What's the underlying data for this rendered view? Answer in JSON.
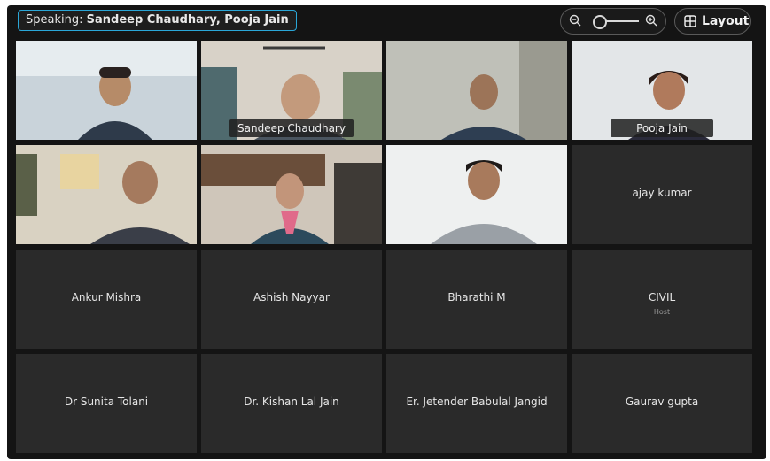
{
  "header": {
    "speaking_label": "Speaking:",
    "speaking_names": "Sandeep Chaudhary, Pooja Jain",
    "layout_label": "Layout"
  },
  "zoom": {
    "level": 0.2
  },
  "participants": [
    {
      "id": "p1",
      "name": "",
      "video": true,
      "active": false
    },
    {
      "id": "p2",
      "name": "Sandeep Chaudhary",
      "video": true,
      "active": true
    },
    {
      "id": "p3",
      "name": "",
      "video": true,
      "active": false
    },
    {
      "id": "p4",
      "name": "Pooja Jain",
      "video": true,
      "active": true
    },
    {
      "id": "p5",
      "name": "",
      "video": true,
      "active": false
    },
    {
      "id": "p6",
      "name": "",
      "video": true,
      "active": false
    },
    {
      "id": "p7",
      "name": "",
      "video": true,
      "active": false
    },
    {
      "id": "p8",
      "name": "ajay kumar",
      "video": false
    },
    {
      "id": "p9",
      "name": "Ankur Mishra",
      "video": false
    },
    {
      "id": "p10",
      "name": "Ashish Nayyar",
      "video": false
    },
    {
      "id": "p11",
      "name": "Bharathi M",
      "video": false
    },
    {
      "id": "p12",
      "name": "CIVIL",
      "role": "Host",
      "video": false
    },
    {
      "id": "p13",
      "name": "Dr Sunita Tolani",
      "video": false
    },
    {
      "id": "p14",
      "name": "Dr. Kishan Lal Jain",
      "video": false
    },
    {
      "id": "p15",
      "name": "Er. Jetender Babulal Jangid",
      "video": false
    },
    {
      "id": "p16",
      "name": "Gaurav gupta",
      "video": false
    }
  ],
  "colors": {
    "accent": "#36b4ee",
    "tile_bg": "#2a2a2a",
    "window_bg": "#141414"
  }
}
